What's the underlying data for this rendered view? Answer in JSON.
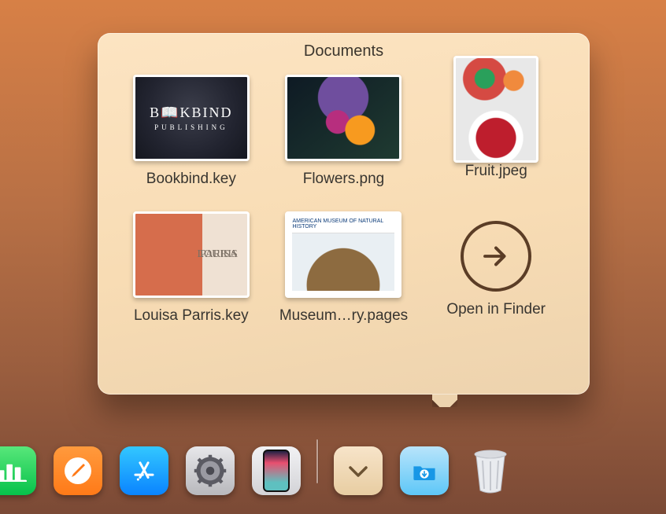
{
  "stack_popover": {
    "title": "Documents",
    "items": [
      {
        "label": "Bookbind.key",
        "kind": "keynote",
        "thumb": "bookbind"
      },
      {
        "label": "Flowers.png",
        "kind": "image",
        "thumb": "flowers"
      },
      {
        "label": "Fruit.jpeg",
        "kind": "image",
        "thumb": "fruit"
      },
      {
        "label": "Louisa Parris.key",
        "kind": "keynote",
        "thumb": "louisa"
      },
      {
        "label": "Museum…ry.pages",
        "kind": "pages",
        "thumb": "museum"
      }
    ],
    "open_in_finder": {
      "label": "Open in Finder"
    },
    "thumbnail_text": {
      "bookbind_line1": "B📖KBIND",
      "bookbind_line2": "PUBLISHING",
      "louisa_line1": "LOUISA",
      "louisa_line2": "PARRIS",
      "museum_header": "AMERICAN MUSEUM OF NATURAL HISTORY"
    }
  },
  "dock": {
    "apps": [
      {
        "id": "numbers",
        "name": "Numbers"
      },
      {
        "id": "pages",
        "name": "Pages"
      },
      {
        "id": "appstore",
        "name": "App Store"
      },
      {
        "id": "settings",
        "name": "System Settings"
      },
      {
        "id": "mirror",
        "name": "iPhone Mirroring"
      }
    ],
    "stacks": [
      {
        "id": "documents",
        "name": "Documents"
      },
      {
        "id": "downloads",
        "name": "Downloads"
      }
    ],
    "trash": {
      "name": "Trash",
      "full": false
    }
  }
}
